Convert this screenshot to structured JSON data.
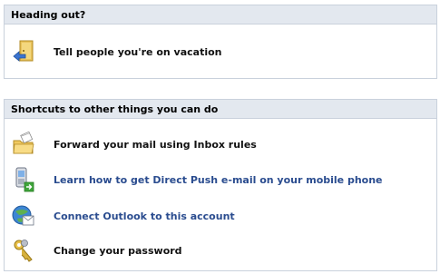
{
  "heading_out": {
    "title": "Heading out?",
    "items": [
      {
        "label": "Tell people you're on vacation",
        "icon": "door-exit-icon"
      }
    ]
  },
  "shortcuts": {
    "title": "Shortcuts to other things you can do",
    "items": [
      {
        "label": "Forward your mail using Inbox rules",
        "icon": "folder-rules-icon"
      },
      {
        "label": "Learn how to get Direct Push e-mail on your mobile phone",
        "icon": "mobile-phone-icon"
      },
      {
        "label": "Connect Outlook to this account",
        "icon": "outlook-connect-icon"
      },
      {
        "label": "Change your password",
        "icon": "keys-icon"
      }
    ]
  },
  "colors": {
    "header_bg": "#e3e8ef",
    "border": "#c9d1dc",
    "link": "#2a4c8f"
  }
}
